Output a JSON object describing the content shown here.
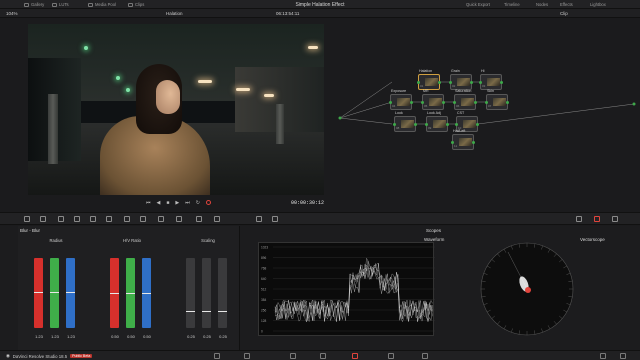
{
  "app": {
    "title": "Simple Halation Effect",
    "left_tabs": [
      "Gallery",
      "LUTs",
      "Media Pool",
      "Clips"
    ],
    "right_tabs": [
      "Quick Export",
      "Timeline",
      "Nodes",
      "Effects",
      "Lightbox"
    ]
  },
  "viewer_bar": {
    "zoom": "104%",
    "clip_name": "Halation",
    "timecode": "06:13:54:11",
    "mode": "Clip"
  },
  "viewer": {
    "timecode": "00:00:30:12"
  },
  "nodes": [
    {
      "label": "Halation",
      "num": "01"
    },
    {
      "label": "Grain",
      "num": "02"
    },
    {
      "label": "Hi",
      "num": "03"
    },
    {
      "label": "Exposure",
      "num": "04"
    },
    {
      "label": "MR",
      "num": "05"
    },
    {
      "label": "Saturation",
      "num": "06"
    },
    {
      "label": "Skin",
      "num": "07"
    },
    {
      "label": "Look",
      "num": "08"
    },
    {
      "label": "Look Adj",
      "num": "09"
    },
    {
      "label": "CST",
      "num": "10"
    },
    {
      "label": "Hal/Left",
      "num": "11"
    }
  ],
  "blur_panel": {
    "title": "Blur - Blur",
    "groups": [
      {
        "label": "Radius",
        "values": [
          "1.23",
          "1.23",
          "1.23"
        ],
        "level": 0.52
      },
      {
        "label": "H/V Ratio",
        "values": [
          "0.50",
          "0.50",
          "0.50"
        ],
        "level": 0.5
      },
      {
        "label": "Scaling",
        "values": [
          "0.25",
          "0.25",
          "0.25"
        ],
        "level": 0.25
      }
    ]
  },
  "scopes": {
    "title": "Scopes",
    "waveform_label": "Waveform",
    "vectorscope_label": "Vectorscope",
    "scale": [
      "1023",
      "896",
      "768",
      "640",
      "512",
      "384",
      "256",
      "128",
      "0"
    ]
  },
  "footer": {
    "brand": "DaVinci Resolve Studio 18.5",
    "badge": "Public Beta"
  },
  "colors": {
    "accent": "#e0443c",
    "node_port": "#3ea84a",
    "selected_node": "#d0a040"
  }
}
